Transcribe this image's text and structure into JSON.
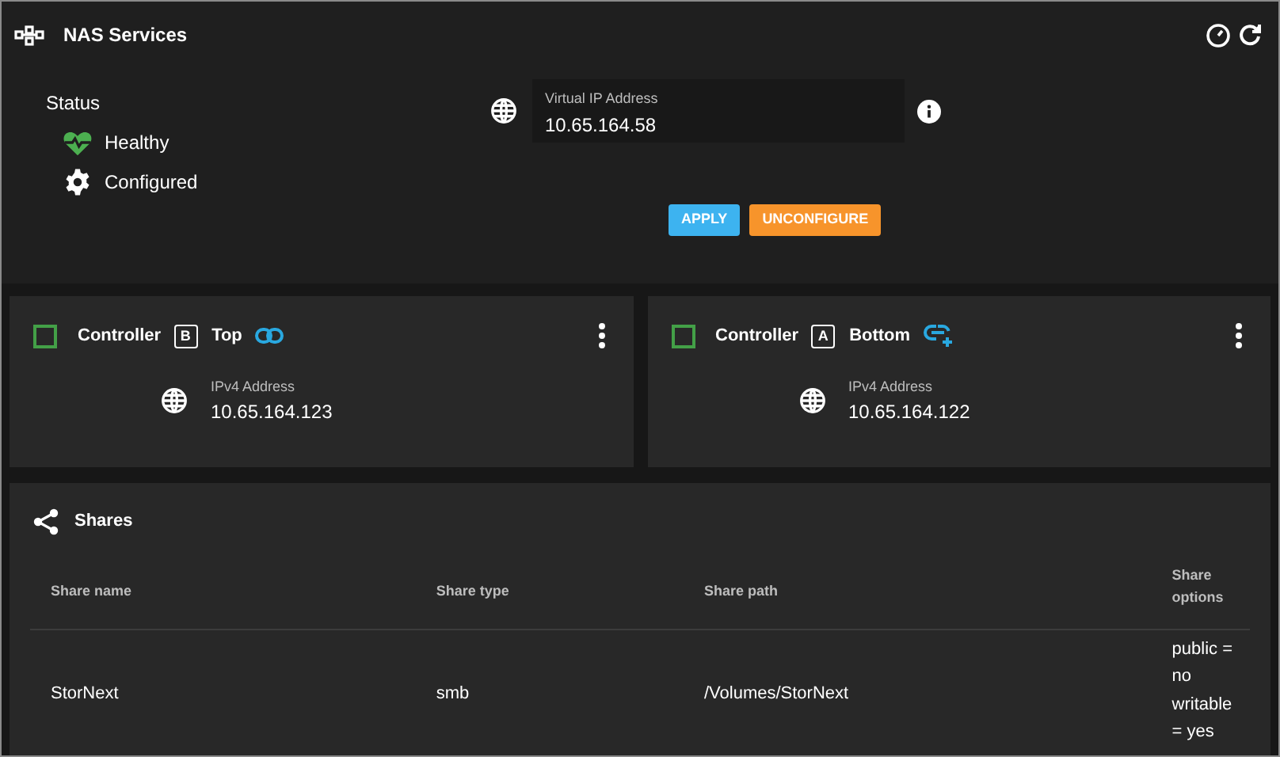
{
  "header": {
    "title": "NAS Services"
  },
  "status": {
    "label": "Status",
    "items": [
      {
        "kind": "health",
        "text": "Healthy"
      },
      {
        "kind": "config",
        "text": "Configured"
      }
    ]
  },
  "virtual_ip": {
    "label": "Virtual IP Address",
    "value": "10.65.164.58"
  },
  "buttons": [
    {
      "kind": "primary",
      "label": "APPLY"
    },
    {
      "kind": "warning",
      "label": "UNCONFIGURE"
    }
  ],
  "controllers": [
    {
      "checked": false,
      "label": "Controller",
      "slot": "B",
      "position": "Top",
      "link": {
        "kind": "linked"
      },
      "address_label": "IPv4 Address",
      "address": "10.65.164.123"
    },
    {
      "checked": false,
      "label": "Controller",
      "slot": "A",
      "position": "Bottom",
      "link": {
        "kind": "add"
      },
      "address_label": "IPv4 Address",
      "address": "10.65.164.122"
    }
  ],
  "shares": {
    "title": "Shares",
    "columns": [
      "Share name",
      "Share type",
      "Share path",
      "Share options"
    ],
    "rows": [
      [
        "StorNext",
        "smb",
        "/Volumes/StorNext",
        "public = no writable = yes"
      ]
    ]
  }
}
